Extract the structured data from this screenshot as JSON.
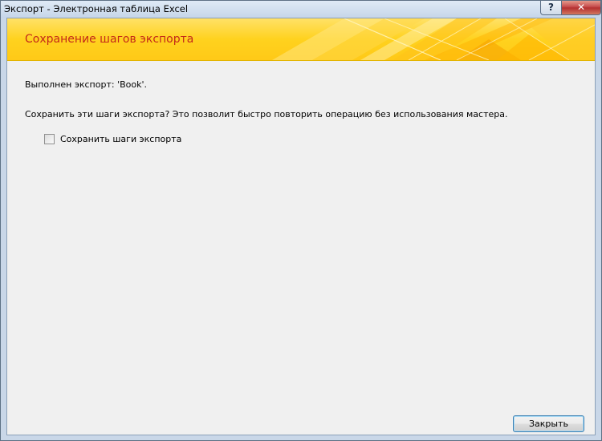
{
  "window": {
    "title": "Экспорт - Электронная таблица Excel",
    "help_glyph": "?",
    "close_glyph": "✕"
  },
  "banner": {
    "title": "Сохранение шагов экспорта"
  },
  "body": {
    "status_message": "Выполнен экспорт: 'Book'.",
    "question": "Сохранить эти шаги экспорта? Это позволит быстро повторить операцию без использования мастера.",
    "save_steps_checkbox": {
      "label": "Сохранить шаги экспорта",
      "checked": false
    }
  },
  "footer": {
    "close_label": "Закрыть"
  },
  "colors": {
    "banner_yellow": "#ffd21e",
    "banner_title": "#c4291a",
    "dialog_background": "#f0f0f0",
    "titlebar_close_red": "#c75050"
  }
}
